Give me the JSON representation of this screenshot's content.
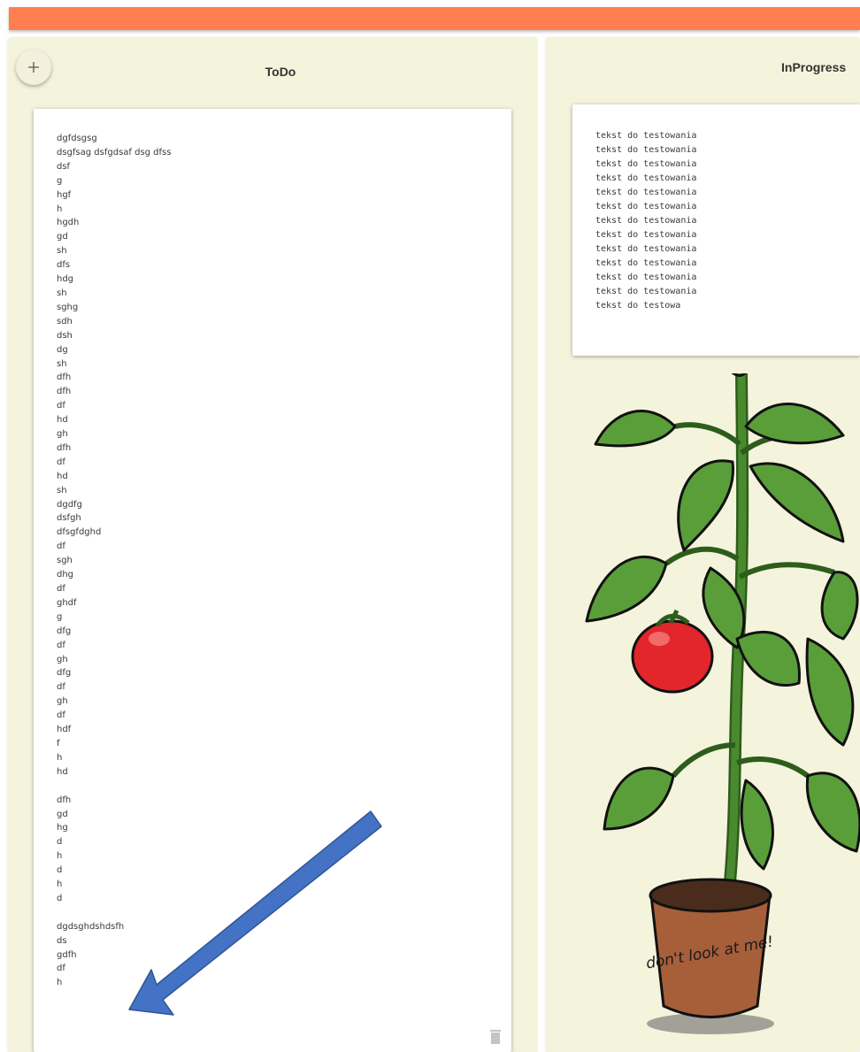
{
  "header": {
    "color": "#ff7f50"
  },
  "columns": {
    "todo": {
      "title": "ToDo",
      "add_icon": "plus-icon",
      "card": {
        "text": "dgfdsgsg\ndsgfsag dsfgdsaf dsg dfss\ndsf\ng\nhgf\nh\nhgdh\ngd\nsh\ndfs\nhdg\nsh\nsghg\nsdh\ndsh\ndg\nsh\ndfh\ndfh\ndf\nhd\ngh\ndfh\ndf\nhd\nsh\ndgdfg\ndsfgh\ndfsgfdghd\ndf\nsgh\ndhg\ndf\nghdf\ng\ndfg\ndf\ngh\ndfg\ndf\ngh\ndf\nhdf\nf\nh\nhd\n\ndfh\ngd\nhg\nd\nh\nd\nh\nd\n\ndgdsghdshdsfh\nds\ngdfh\ndf\nh",
        "delete_icon": "trash-icon"
      }
    },
    "inprogress": {
      "title": "InProgress",
      "card": {
        "text": "tekst do testowania\ntekst do testowania\ntekst do testowania\ntekst do testowania\ntekst do testowania\ntekst do testowania\ntekst do testowania\ntekst do testowania\ntekst do testowania\ntekst do testowania\ntekst do testowania\ntekst do testowania\ntekst do testowa"
      },
      "illustration": {
        "pot_text": "don't look at me!"
      }
    }
  },
  "annotation": {
    "arrow_color": "#4472c4"
  }
}
